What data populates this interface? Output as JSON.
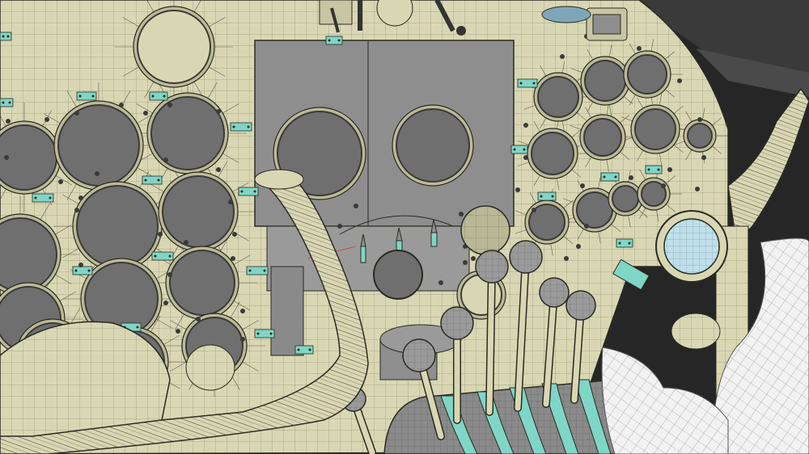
{
  "scene": {
    "subject": "wireframe-cockpit-instrument-panel",
    "colors": {
      "panel": "#d9d7b3",
      "panel_shadow": "#bdbb97",
      "wire": "#2a2a22",
      "gauge_face": "#6f6f6f",
      "gauge_rim": "#3a3a3a",
      "center_plate": "#8e8e8e",
      "teal": "#7fd6c6",
      "dark_bg": "#262626",
      "ghost": "#f2f2f2",
      "lens": "#bfe0ea",
      "red_axis": "#d23c3c"
    },
    "gauge_count_visible": 40,
    "lever_count": 6
  }
}
